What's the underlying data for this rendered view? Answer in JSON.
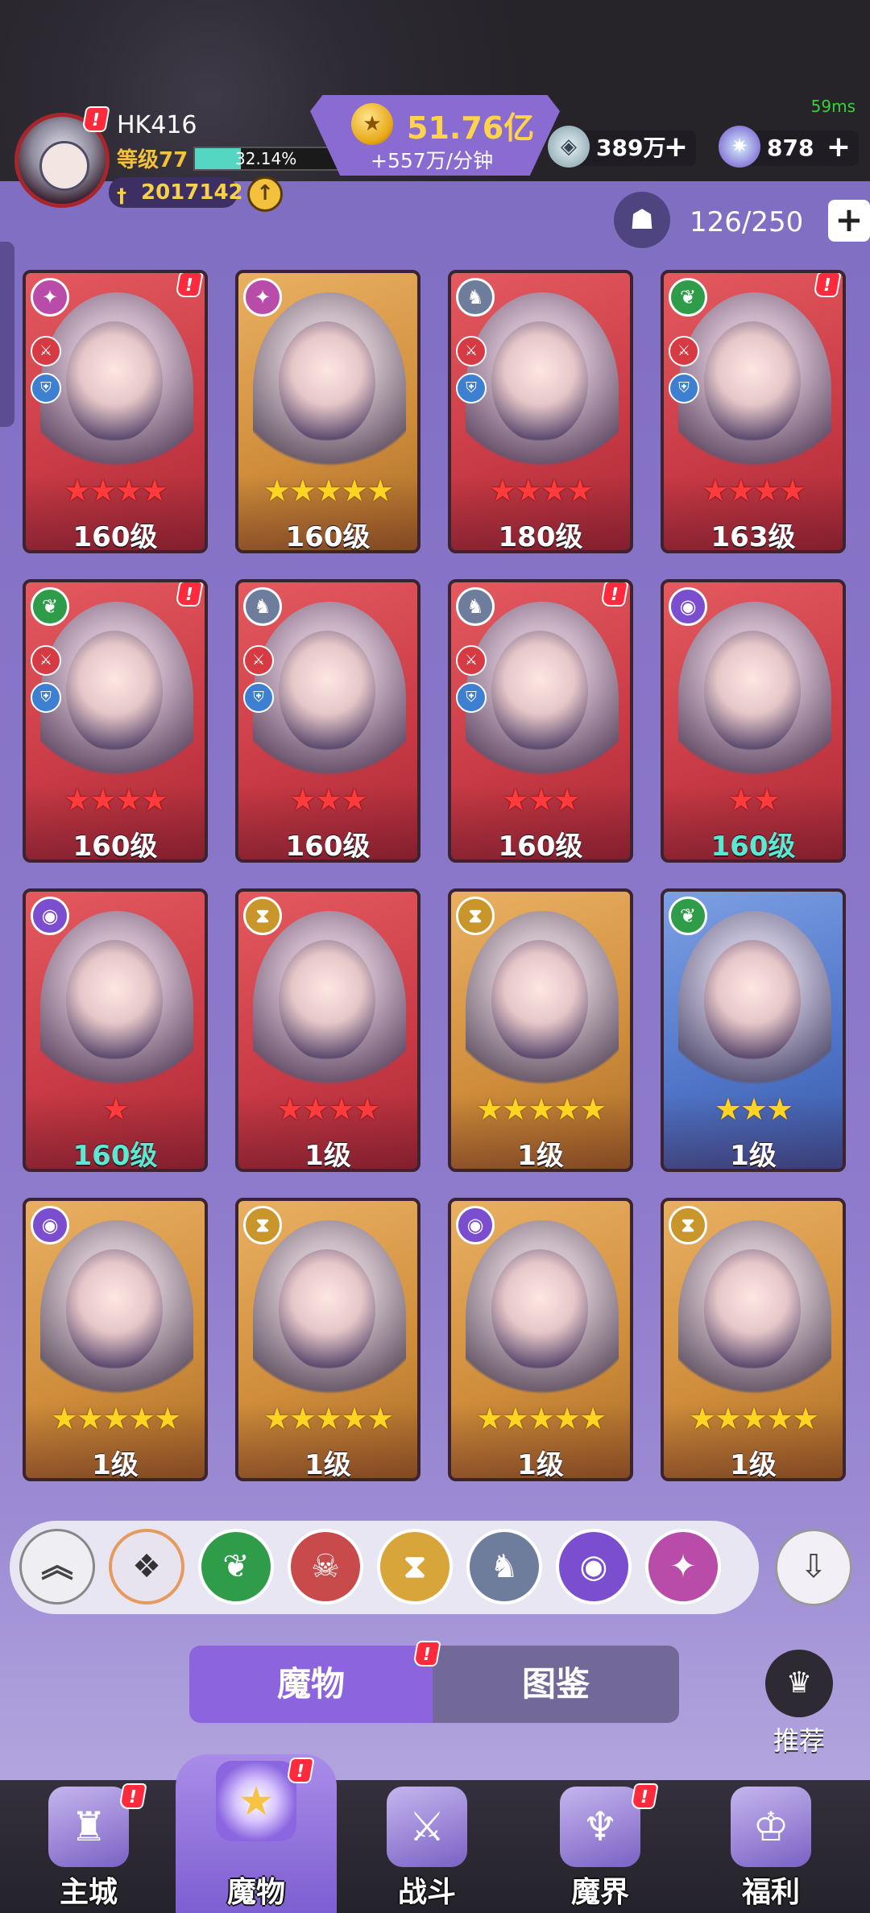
{
  "status": {
    "ping": "59ms"
  },
  "player": {
    "name": "HK416",
    "level": "等级77",
    "xp_text": "32.14%",
    "xp_fraction": 0.3214,
    "power": "2017142"
  },
  "resources": {
    "gold": {
      "value": "51.76亿",
      "rate": "+557万/分钟",
      "icon": "gold-coin"
    },
    "crystal": {
      "value": "389万",
      "plus": "+",
      "icon": "crystal-orb"
    },
    "gem": {
      "value": "878",
      "plus": "+",
      "icon": "star-gem"
    }
  },
  "capacity": {
    "text": "126/250",
    "plus": "+",
    "icon": "monster-mask"
  },
  "alert_mark": "!",
  "cards": [
    {
      "bg": "red",
      "faction_icon": "pink-swirl",
      "faction_glyph": "✦",
      "stars": "★★★★",
      "star_color": "red",
      "level": "160级",
      "level_color": "white",
      "roles": [
        "sword",
        "shield"
      ],
      "alert": true
    },
    {
      "bg": "gold",
      "faction_icon": "pink-swirl",
      "faction_glyph": "✦",
      "stars": "★★★★★",
      "star_color": "gold",
      "level": "160级",
      "level_color": "white",
      "roles": [],
      "alert": false
    },
    {
      "bg": "red",
      "faction_icon": "silver-wolf",
      "faction_glyph": "♞",
      "stars": "★★★★",
      "star_color": "red",
      "level": "180级",
      "level_color": "white",
      "roles": [
        "sword",
        "shield"
      ],
      "alert": false
    },
    {
      "bg": "red",
      "faction_icon": "green-leaf",
      "faction_glyph": "❦",
      "stars": "★★★★",
      "star_color": "red",
      "level": "163级",
      "level_color": "white",
      "roles": [
        "sword",
        "shield"
      ],
      "alert": true
    },
    {
      "bg": "red",
      "faction_icon": "green-leaf",
      "faction_glyph": "❦",
      "stars": "★★★★",
      "star_color": "red",
      "level": "160级",
      "level_color": "white",
      "roles": [
        "sword",
        "shield"
      ],
      "alert": true
    },
    {
      "bg": "red",
      "faction_icon": "silver-wolf",
      "faction_glyph": "♞",
      "stars": "★★★",
      "star_color": "red",
      "level": "160级",
      "level_color": "white",
      "roles": [
        "sword",
        "shield"
      ],
      "alert": false
    },
    {
      "bg": "red",
      "faction_icon": "silver-wolf",
      "faction_glyph": "♞",
      "stars": "★★★",
      "star_color": "red",
      "level": "160级",
      "level_color": "white",
      "roles": [
        "sword",
        "shield"
      ],
      "alert": true
    },
    {
      "bg": "red",
      "faction_icon": "purple-eye",
      "faction_glyph": "◉",
      "stars": "★★",
      "star_color": "red",
      "level": "160级",
      "level_color": "teal",
      "roles": [],
      "alert": false
    },
    {
      "bg": "red",
      "faction_icon": "purple-eye",
      "faction_glyph": "◉",
      "stars": "★",
      "star_color": "red",
      "level": "160级",
      "level_color": "teal",
      "roles": [],
      "alert": false
    },
    {
      "bg": "red",
      "faction_icon": "gold-hourglass",
      "faction_glyph": "⧗",
      "stars": "★★★★",
      "star_color": "red",
      "level": "1级",
      "level_color": "white",
      "roles": [],
      "alert": false
    },
    {
      "bg": "gold",
      "faction_icon": "gold-hourglass",
      "faction_glyph": "⧗",
      "stars": "★★★★★",
      "star_color": "gold",
      "level": "1级",
      "level_color": "white",
      "roles": [],
      "alert": false
    },
    {
      "bg": "blue",
      "faction_icon": "green-leaf",
      "faction_glyph": "❦",
      "stars": "★★★",
      "star_color": "gold",
      "level": "1级",
      "level_color": "white",
      "roles": [],
      "alert": false
    },
    {
      "bg": "gold",
      "faction_icon": "purple-eye",
      "faction_glyph": "◉",
      "stars": "★★★★★",
      "star_color": "gold",
      "level": "1级",
      "level_color": "white",
      "roles": [],
      "alert": false
    },
    {
      "bg": "gold",
      "faction_icon": "gold-hourglass",
      "faction_glyph": "⧗",
      "stars": "★★★★★",
      "star_color": "gold",
      "level": "1级",
      "level_color": "white",
      "roles": [],
      "alert": false
    },
    {
      "bg": "gold",
      "faction_icon": "purple-eye",
      "faction_glyph": "◉",
      "stars": "★★★★★",
      "star_color": "gold",
      "level": "1级",
      "level_color": "white",
      "roles": [],
      "alert": false
    },
    {
      "bg": "gold",
      "faction_icon": "gold-hourglass",
      "faction_glyph": "⧗",
      "stars": "★★★★★",
      "star_color": "gold",
      "level": "1级",
      "level_color": "white",
      "roles": [],
      "alert": false
    }
  ],
  "filters": [
    {
      "name": "collapse-chevrons",
      "glyph": "︽",
      "cls": "up"
    },
    {
      "name": "all-factions",
      "glyph": "❖",
      "cls": "all"
    },
    {
      "name": "nature-leaf",
      "glyph": "❦",
      "color": "#2f9c4a"
    },
    {
      "name": "demon-mask",
      "glyph": "☠",
      "color": "#c84a4a"
    },
    {
      "name": "hourglass",
      "glyph": "⧗",
      "color": "#d7a53a"
    },
    {
      "name": "wolf",
      "glyph": "♞",
      "color": "#6f7d9c"
    },
    {
      "name": "eye",
      "glyph": "◉",
      "color": "#7b4ed0"
    },
    {
      "name": "swirl",
      "glyph": "✦",
      "color": "#b94ba9"
    }
  ],
  "sort_glyph": "⇩",
  "tabs": {
    "monsters": "魔物",
    "codex": "图鉴"
  },
  "recommend": {
    "label": "推荐",
    "icon": "three-people"
  },
  "nav": [
    {
      "label": "主城",
      "icon": "castle",
      "glyph": "♜",
      "alert": true,
      "active": false
    },
    {
      "label": "魔物",
      "icon": "purple-flame-star",
      "glyph": "★",
      "alert": true,
      "active": true
    },
    {
      "label": "战斗",
      "icon": "shield-sword",
      "glyph": "⚔",
      "alert": false,
      "active": false
    },
    {
      "label": "魔界",
      "icon": "demon-portal",
      "glyph": "♆",
      "alert": true,
      "active": false
    },
    {
      "label": "福利",
      "icon": "treasure-chest",
      "glyph": "♔",
      "alert": false,
      "active": false
    }
  ]
}
